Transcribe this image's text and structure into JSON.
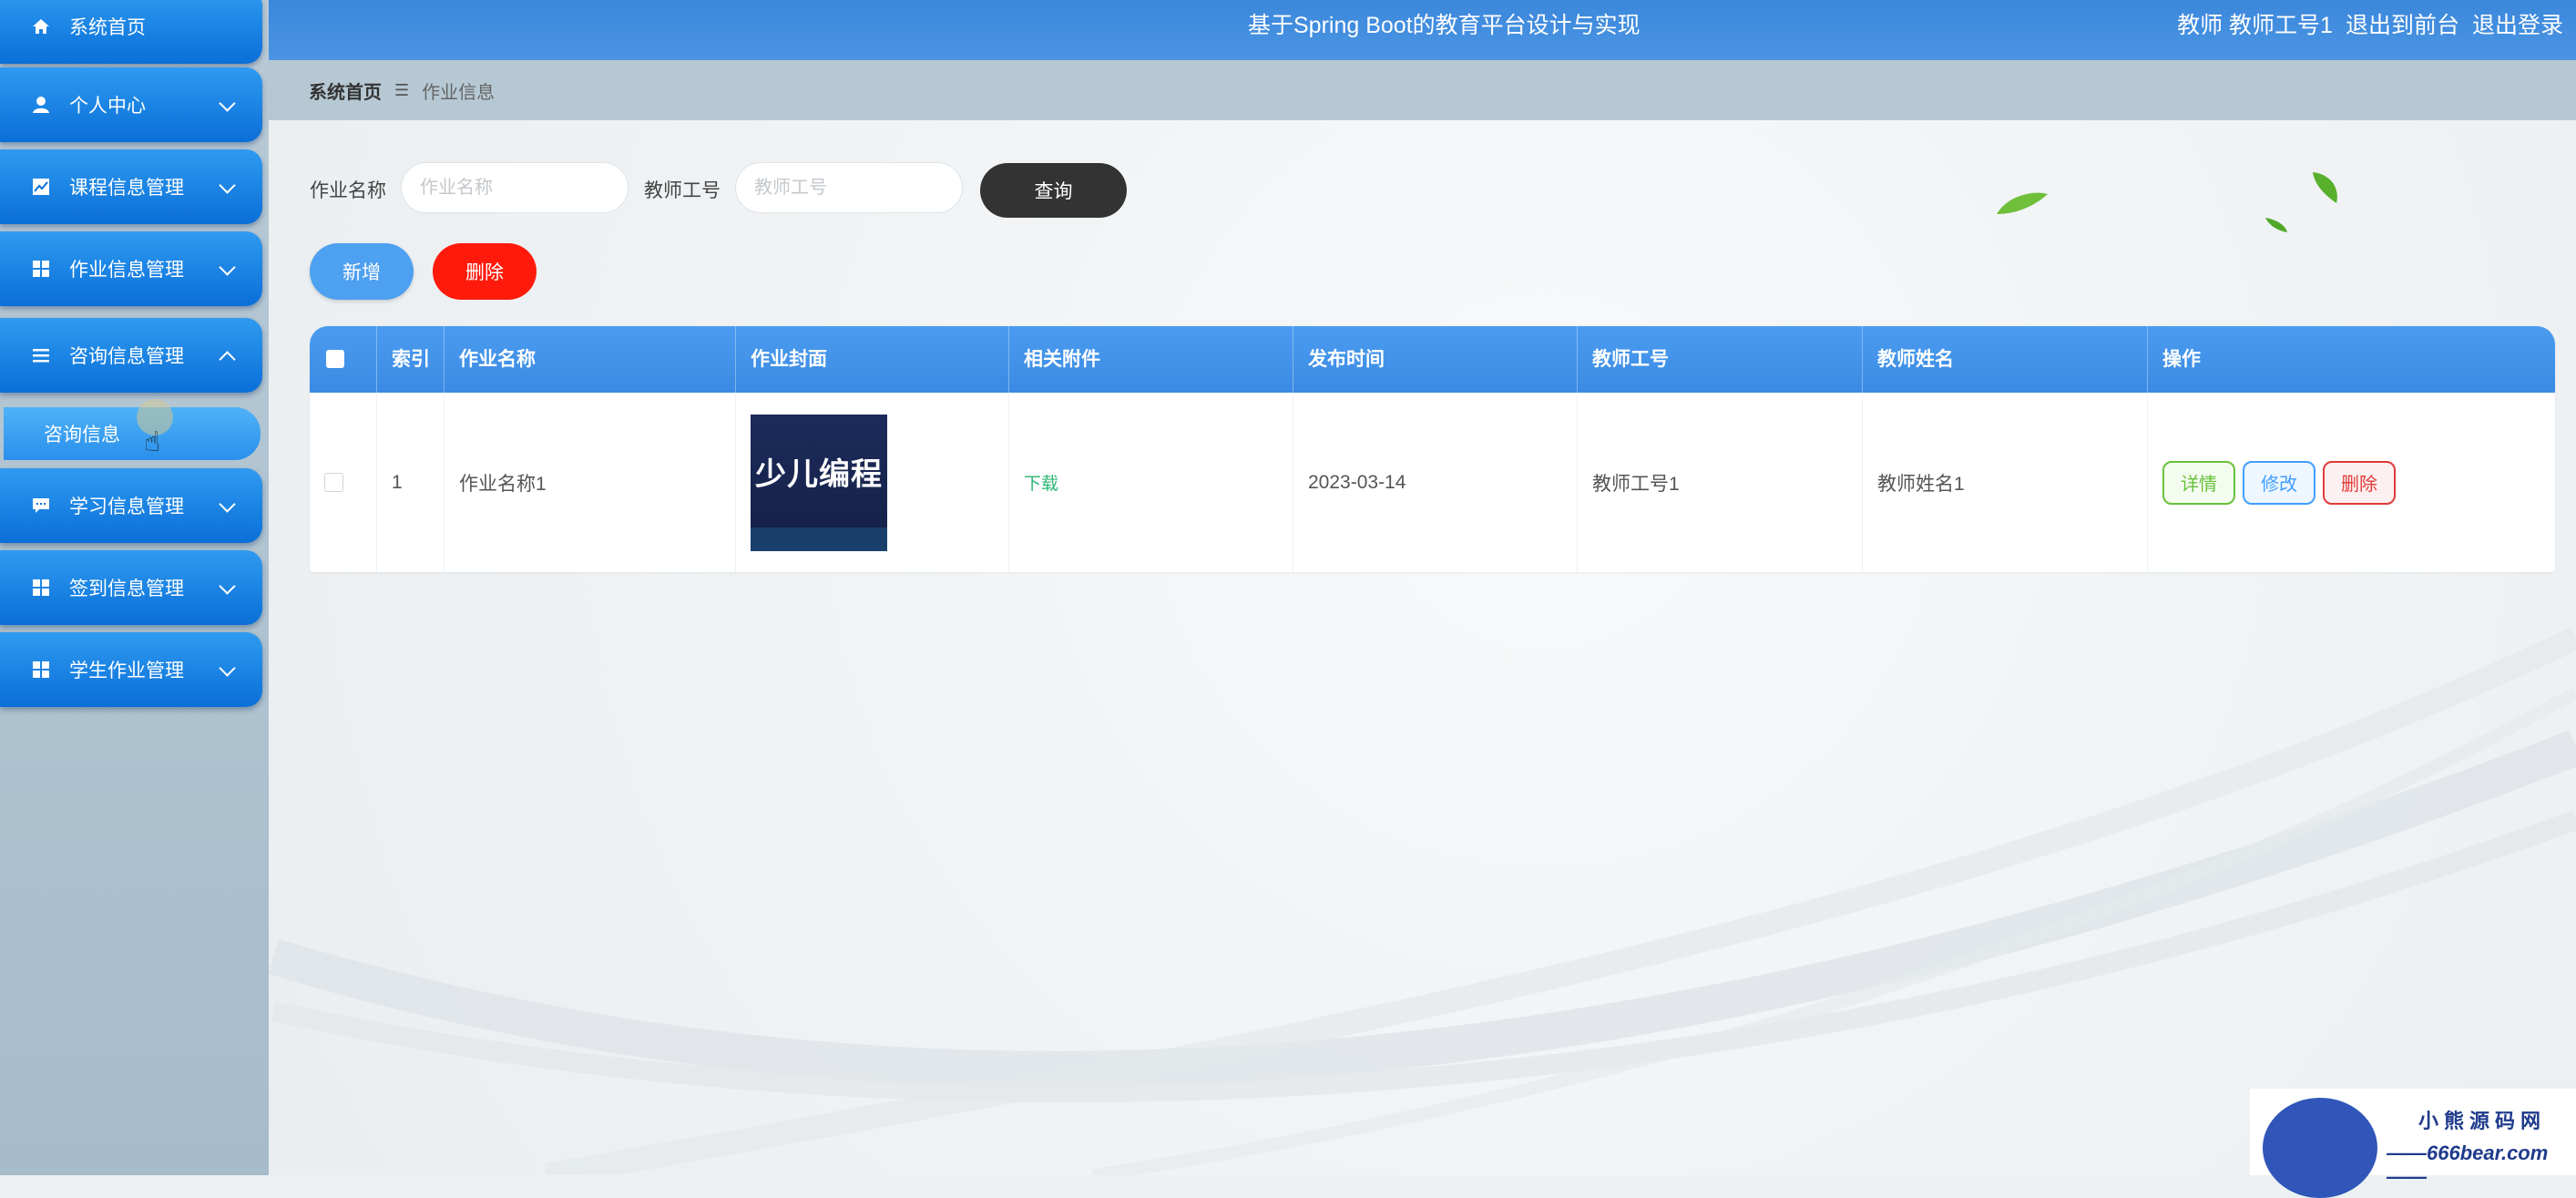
{
  "app": {
    "title": "基于Spring Boot的教育平台设计与实现",
    "user_label": "教师 教师工号1",
    "to_front": "退出到前台",
    "logout": "退出登录"
  },
  "sidebar": {
    "items": [
      {
        "label": "系统首页",
        "icon": "home-icon"
      },
      {
        "label": "个人中心",
        "icon": "person-icon"
      },
      {
        "label": "课程信息管理",
        "icon": "chart-icon"
      },
      {
        "label": "作业信息管理",
        "icon": "grid-icon"
      },
      {
        "label": "咨询信息管理",
        "icon": "list-icon",
        "expanded": true
      },
      {
        "label": "学习信息管理",
        "icon": "chat-icon"
      },
      {
        "label": "签到信息管理",
        "icon": "grid-icon"
      },
      {
        "label": "学生作业管理",
        "icon": "grid-icon"
      }
    ],
    "sub_item": "咨询信息"
  },
  "breadcrumb": {
    "home": "系统首页",
    "current": "作业信息"
  },
  "search": {
    "name_label": "作业名称",
    "name_placeholder": "作业名称",
    "teacher_label": "教师工号",
    "teacher_placeholder": "教师工号",
    "query_button": "查询"
  },
  "actions": {
    "add": "新增",
    "delete": "删除"
  },
  "table": {
    "headers": [
      "索引",
      "作业名称",
      "作业封面",
      "相关附件",
      "发布时间",
      "教师工号",
      "教师姓名",
      "操作"
    ],
    "rows": [
      {
        "index": "1",
        "name": "作业名称1",
        "cover_text": "少儿编程",
        "attachment": "下载",
        "date": "2023-03-14",
        "teacher_id": "教师工号1",
        "teacher_name": "教师姓名1",
        "ops": {
          "detail": "详情",
          "edit": "修改",
          "delete": "删除"
        }
      }
    ]
  },
  "watermark": {
    "line1": "小熊源码网",
    "line2": "——666bear.com——"
  },
  "colors": {
    "header": "#3b87db",
    "sidebar_item": "#0a6fd8",
    "query_button": "#333333",
    "add_button": "#4ea0f0",
    "delete_button": "#ff1a0c"
  }
}
